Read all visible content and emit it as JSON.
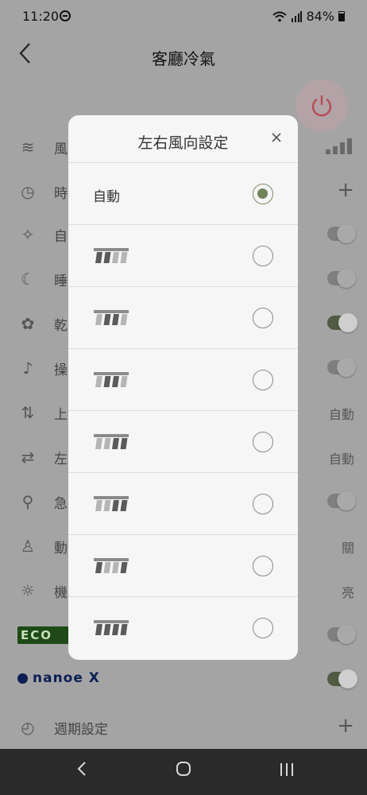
{
  "status_bar": {
    "time": "11:20",
    "battery": "84%",
    "icons": [
      "dnd-icon",
      "wifi-icon",
      "signal-icon",
      "battery-icon"
    ]
  },
  "header": {
    "title": "客廳冷氣",
    "back_icon": "chevron-left-icon"
  },
  "power": {
    "icon": "power-icon",
    "color": "#b84a55"
  },
  "background_settings": [
    {
      "icon": "wind-icon",
      "label": "風",
      "control": "fan-level"
    },
    {
      "icon": "clock-icon",
      "label": "時",
      "control": "plus"
    },
    {
      "icon": "sparkle-icon",
      "label": "自",
      "control": "toggle",
      "on": false
    },
    {
      "icon": "sleep-icon",
      "label": "睡",
      "control": "toggle",
      "on": false
    },
    {
      "icon": "dry-icon",
      "label": "乾",
      "control": "toggle",
      "on": true
    },
    {
      "icon": "music-note-icon",
      "label": "操",
      "control": "toggle",
      "on": false
    },
    {
      "icon": "updown-arrows-icon",
      "label": "上",
      "control": "value",
      "value": "自動"
    },
    {
      "icon": "leftright-arrows-icon",
      "label": "左",
      "control": "value",
      "value": "自動"
    },
    {
      "icon": "boost-icon",
      "label": "急",
      "control": "toggle",
      "on": false
    },
    {
      "icon": "person-icon",
      "label": "動",
      "control": "value",
      "value": "關"
    },
    {
      "icon": "bulb-icon",
      "label": "機",
      "control": "value",
      "value": "亮"
    },
    {
      "icon": "eco-logo",
      "label": "ECO",
      "control": "toggle",
      "on": false
    },
    {
      "icon": "nanoe-x-logo",
      "label": "nanoe X",
      "control": "toggle",
      "on": true
    },
    {
      "icon": "schedule-icon",
      "label": "週期設定",
      "control": "plus"
    }
  ],
  "modal": {
    "title": "左右風向設定",
    "close_icon": "close-icon",
    "options": [
      {
        "label": "自動",
        "icon": null,
        "selected": true
      },
      {
        "label": "",
        "icon": "louver-left-icon",
        "highlight": [
          0,
          1
        ],
        "selected": false
      },
      {
        "label": "",
        "icon": "louver-left-center-icon",
        "highlight": [
          1,
          2
        ],
        "selected": false
      },
      {
        "label": "",
        "icon": "louver-center-icon",
        "highlight": [
          1,
          2
        ],
        "selected": false
      },
      {
        "label": "",
        "icon": "louver-right-center-icon",
        "highlight": [
          2,
          3
        ],
        "selected": false
      },
      {
        "label": "",
        "icon": "louver-right-icon",
        "highlight": [
          2,
          3
        ],
        "selected": false
      },
      {
        "label": "",
        "icon": "louver-spread-icon",
        "highlight": [
          0,
          3
        ],
        "selected": false
      },
      {
        "label": "",
        "icon": "louver-swing-icon",
        "highlight": [
          0,
          1,
          2,
          3
        ],
        "selected": false
      }
    ],
    "accent_color": "#6f8458"
  },
  "navbar": {
    "back_icon": "nav-back-icon",
    "home_icon": "nav-home-icon",
    "recents_icon": "nav-recents-icon"
  }
}
